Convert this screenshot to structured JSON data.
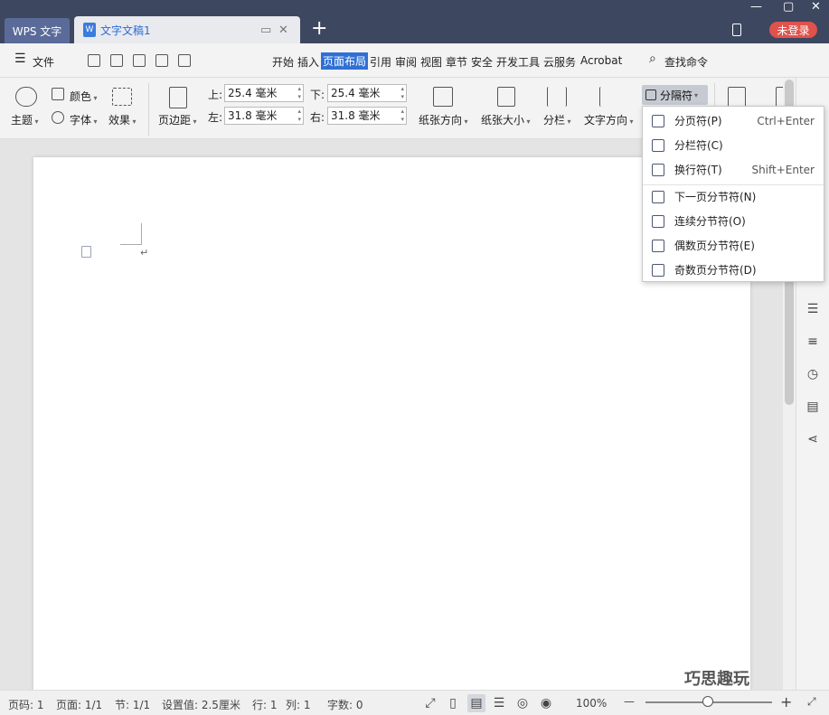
{
  "titlebar": {
    "app_tab": "WPS 文字",
    "doc_tab": "文字文稿1",
    "doc_icon": "W",
    "newtab": "+",
    "login": "未登录",
    "win_min": "—",
    "win_max": "▢",
    "win_close": "✕",
    "tab_restore": "▭",
    "tab_close": "✕"
  },
  "menubar": {
    "file": "文件",
    "hamburger": "☰",
    "items": [
      "开始",
      "插入",
      "页面布局",
      "引用",
      "审阅",
      "视图",
      "章节",
      "安全",
      "开发工具",
      "云服务",
      "Acrobat"
    ],
    "active": "页面布局",
    "search": "查找命令",
    "search_icon": "⌕"
  },
  "ribbon": {
    "theme": "主题",
    "color": "颜色",
    "font": "字体",
    "effect": "效果",
    "margin": "页边距",
    "top_label": "上:",
    "top_value": "25.4 毫米",
    "bottom_label": "下:",
    "bottom_value": "25.4 毫米",
    "left_label": "左:",
    "left_value": "31.8 毫米",
    "right_label": "右:",
    "right_value": "31.8 毫米",
    "orientation": "纸张方向",
    "size": "纸张大小",
    "columns": "分栏",
    "text_dir": "文字方向",
    "separator": "分隔符"
  },
  "dropdown": {
    "items": [
      {
        "label": "分页符(P)",
        "shortcut": "Ctrl+Enter"
      },
      {
        "label": "分栏符(C)",
        "shortcut": ""
      },
      {
        "label": "换行符(T)",
        "shortcut": "Shift+Enter"
      },
      {
        "label": "下一页分节符(N)",
        "shortcut": ""
      },
      {
        "label": "连续分节符(O)",
        "shortcut": ""
      },
      {
        "label": "偶数页分节符(E)",
        "shortcut": ""
      },
      {
        "label": "奇数页分节符(D)",
        "shortcut": ""
      }
    ]
  },
  "document": {
    "pilcrow": "↵"
  },
  "statusbar": {
    "page_num": "页码: 1",
    "pages": "页面: 1/1",
    "section": "节: 1/1",
    "setting": "设置值: 2.5厘米",
    "row": "行: 1",
    "col": "列: 1",
    "words": "字数: 0",
    "zoom": "100%",
    "zoom_minus": "—",
    "zoom_plus": "+",
    "fit_icon": "⤢"
  },
  "watermark": "巧思趣玩",
  "colors": {
    "titlebar": "#3d4760",
    "accent": "#3070d5",
    "login": "#e0524c"
  }
}
